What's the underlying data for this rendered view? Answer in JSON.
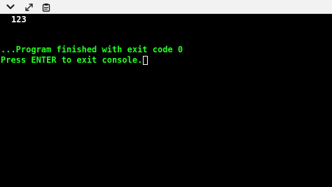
{
  "toolbar": {
    "buttons": [
      {
        "icon": "chevron-down-icon"
      },
      {
        "icon": "expand-icon"
      },
      {
        "icon": "copy-to-clipboard-icon"
      }
    ]
  },
  "console": {
    "output": "123",
    "exit_message": "...Program finished with exit code 0",
    "prompt": "Press ENTER to exit console.",
    "text_color": "#22ff22",
    "output_color": "#ffffff",
    "background": "#000000"
  }
}
